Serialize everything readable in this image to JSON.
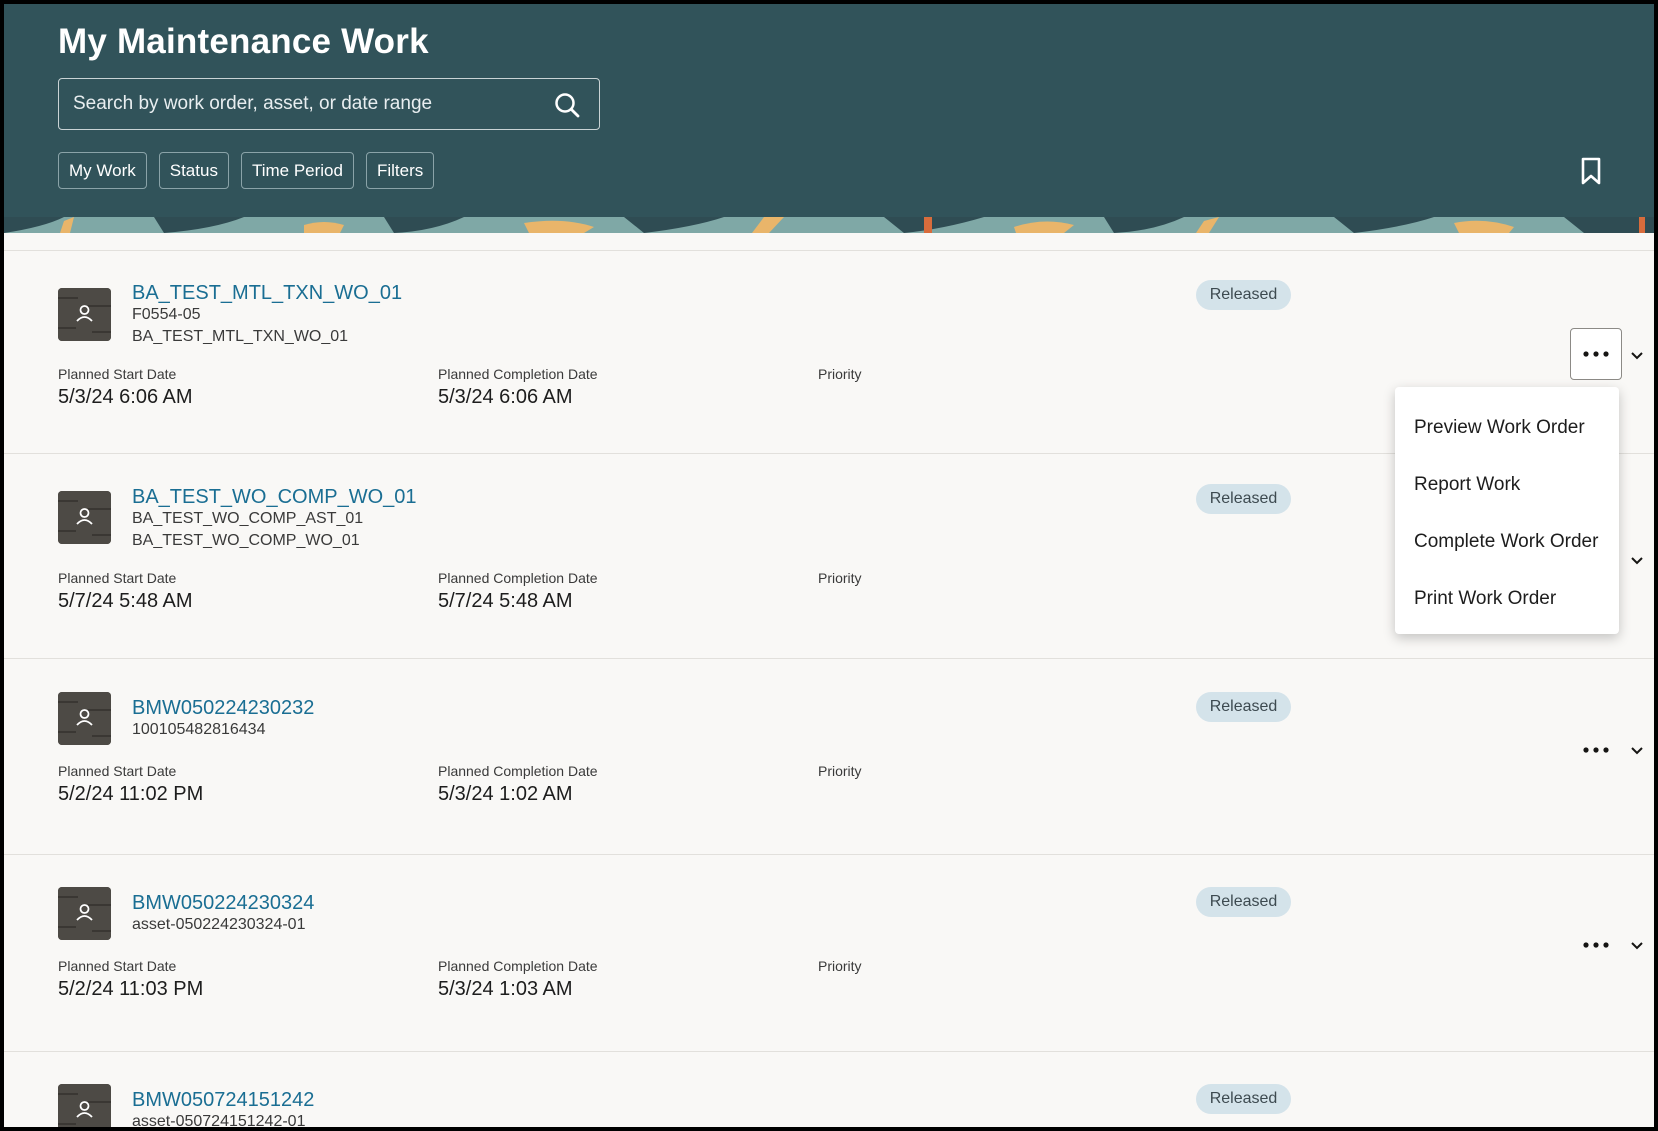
{
  "header": {
    "title": "My Maintenance Work",
    "search_placeholder": "Search by work order, asset, or date range",
    "chips": [
      "My Work",
      "Status",
      "Time Period",
      "Filters"
    ]
  },
  "labels": {
    "start": "Planned Start Date",
    "completion": "Planned Completion Date",
    "priority": "Priority"
  },
  "work_orders": [
    {
      "name": "BA_TEST_MTL_TXN_WO_01",
      "line1": "F0554-05",
      "line2": "BA_TEST_MTL_TXN_WO_01",
      "status": "Released",
      "start": "5/3/24 6:06 AM",
      "completion": "5/3/24 6:06 AM"
    },
    {
      "name": "BA_TEST_WO_COMP_WO_01",
      "line1": "BA_TEST_WO_COMP_AST_01",
      "line2": "BA_TEST_WO_COMP_WO_01",
      "status": "Released",
      "start": "5/7/24 5:48 AM",
      "completion": "5/7/24 5:48 AM"
    },
    {
      "name": "BMW050224230232",
      "line1": "100105482816434",
      "status": "Released",
      "start": "5/2/24 11:02 PM",
      "completion": "5/3/24 1:02 AM"
    },
    {
      "name": "BMW050224230324",
      "line1": "asset-050224230324-01",
      "status": "Released",
      "start": "5/2/24 11:03 PM",
      "completion": "5/3/24 1:03 AM"
    },
    {
      "name": "BMW050724151242",
      "line1": "asset-050724151242-01",
      "status": "Released"
    }
  ],
  "actions_menu": {
    "items": [
      "Preview Work Order",
      "Report Work",
      "Complete Work Order",
      "Print Work Order"
    ]
  },
  "icons": {
    "search": "search-icon",
    "bookmark": "bookmark-icon",
    "more": "more-actions-icon",
    "chevron": "chevron-down-icon",
    "avatar": "person-icon"
  },
  "colors": {
    "header_bg": "#31535a",
    "link": "#1a6e93",
    "badge_bg": "#d4e3ea"
  }
}
